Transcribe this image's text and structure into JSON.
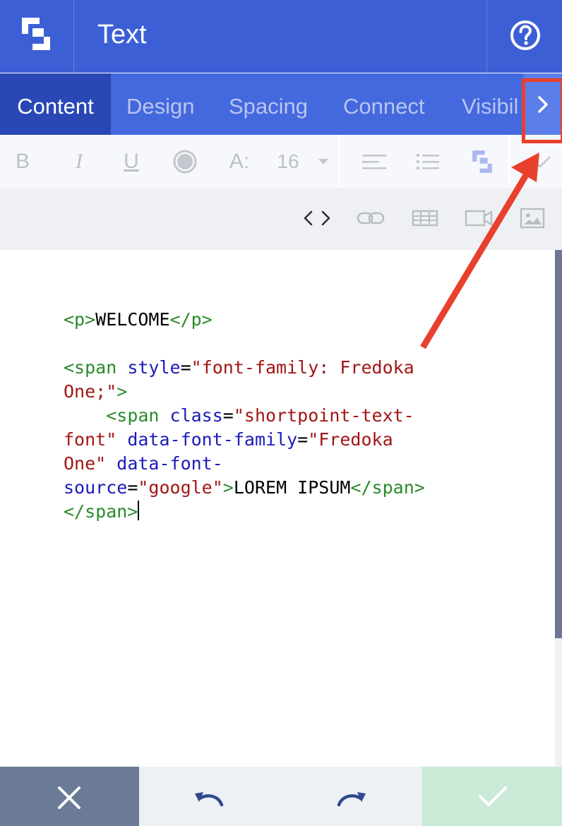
{
  "header": {
    "title": "Text",
    "logo_icon": "shortpoint-logo-icon",
    "help_icon": "help-circle-icon"
  },
  "tabs": [
    {
      "label": "Content",
      "active": true
    },
    {
      "label": "Design",
      "active": false
    },
    {
      "label": "Spacing",
      "active": false
    },
    {
      "label": "Connect",
      "active": false
    },
    {
      "label": "Visibil",
      "active": false
    }
  ],
  "tabs_next_icon": "chevron-right-icon",
  "format_toolbar": {
    "bold": "B",
    "italic": "I",
    "underline": "U",
    "font_size_prefix": "A:",
    "font_size": "16"
  },
  "code_editor": {
    "lines": [
      "<p>WELCOME</p>",
      "",
      "<span style=\"font-family: Fredoka",
      "One;\">",
      "    <span class=\"shortpoint-text-",
      "font\" data-font-family=\"Fredoka",
      "One\" data-font-",
      "source=\"google\">LOREM IPSUM</span>",
      "</span>"
    ]
  },
  "bottom_bar": {
    "cancel_icon": "close-icon",
    "undo_icon": "undo-icon",
    "redo_icon": "redo-icon",
    "confirm_icon": "check-icon"
  },
  "colors": {
    "header": "#3d5fd6",
    "tab_bar": "#4468dd",
    "active_tab": "#2a48b5",
    "annotation": "#e8402c"
  }
}
